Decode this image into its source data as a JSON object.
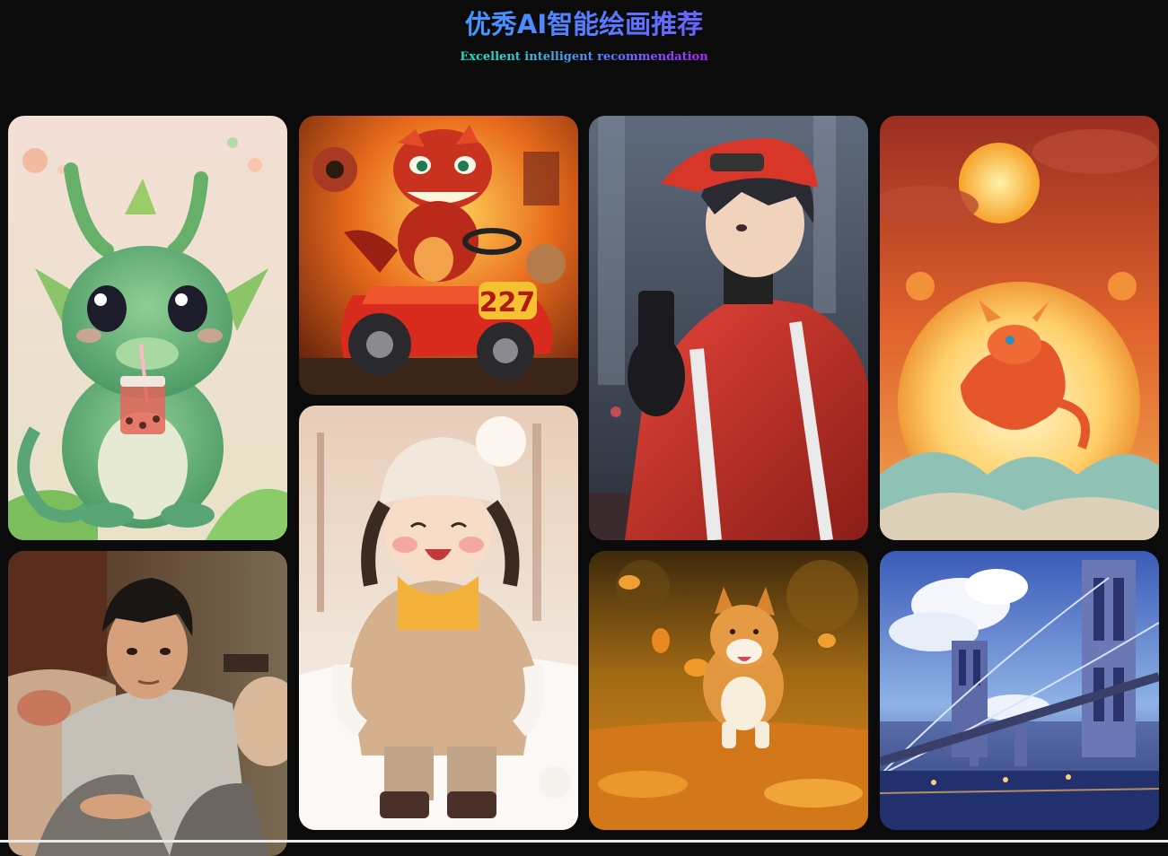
{
  "header": {
    "title": "优秀AI智能绘画推荐",
    "subtitle": "Excellent intelligent recommendation"
  },
  "gallery": {
    "items": [
      {
        "name": "baby-dragon-bubble-tea",
        "icon": "green-dragon-image"
      },
      {
        "name": "dragon-race-car",
        "icon": "red-dragon-car-image"
      },
      {
        "name": "boy-red-jacket-city",
        "icon": "anime-boy-image"
      },
      {
        "name": "dragon-sunset-clouds",
        "icon": "golden-dragon-image"
      },
      {
        "name": "boy-portrait-sofa",
        "icon": "boy-portrait-image"
      },
      {
        "name": "girl-snow-winter",
        "icon": "snow-girl-image"
      },
      {
        "name": "shiba-autumn-leaves",
        "icon": "shiba-dog-image"
      },
      {
        "name": "bridge-city-sky",
        "icon": "bridge-image"
      }
    ],
    "car_number": "227"
  },
  "colors": {
    "background": "#0b0b0c",
    "title_gradient": [
      "#22e0c8",
      "#3aa4ff",
      "#7a4bff",
      "#b025ff"
    ]
  }
}
